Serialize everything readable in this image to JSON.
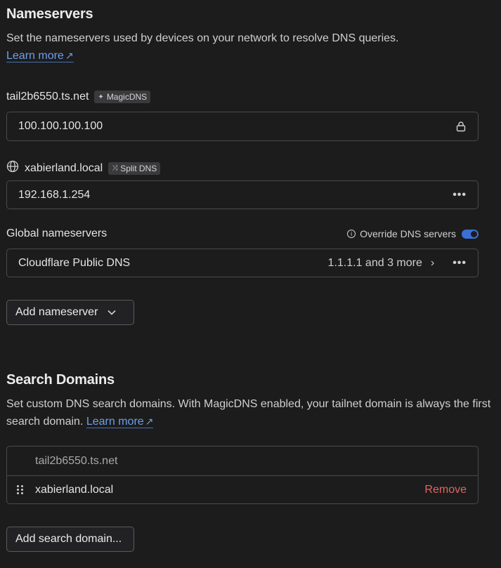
{
  "nameservers": {
    "title": "Nameservers",
    "description": "Set the nameservers used by devices on your network to resolve DNS queries.",
    "learn_more": "Learn more",
    "magic": {
      "domain": "tail2b6550.ts.net",
      "badge": "MagicDNS",
      "badge_icon": "sparkle-icon",
      "value": "100.100.100.100"
    },
    "split": {
      "domain": "xabierland.local",
      "badge": "Split DNS",
      "badge_icon": "shuffle-icon",
      "value": "192.168.1.254"
    },
    "global": {
      "label": "Global nameservers",
      "override_label": "Override DNS servers",
      "override_on": true,
      "provider": "Cloudflare Public DNS",
      "summary": "1.1.1.1 and 3 more"
    },
    "add_button": "Add nameserver"
  },
  "search_domains": {
    "title": "Search Domains",
    "description": "Set custom DNS search domains. With MagicDNS enabled, your tailnet domain is always the first search domain.",
    "learn_more": "Learn more",
    "domains": [
      {
        "name": "tail2b6550.ts.net"
      },
      {
        "name": "xabierland.local",
        "action": "Remove"
      }
    ],
    "add_button": "Add search domain..."
  },
  "colors": {
    "background": "#1c1c1d",
    "link": "#6f9fe6",
    "danger": "#e0655c",
    "toggle": "#3b6fd6"
  }
}
